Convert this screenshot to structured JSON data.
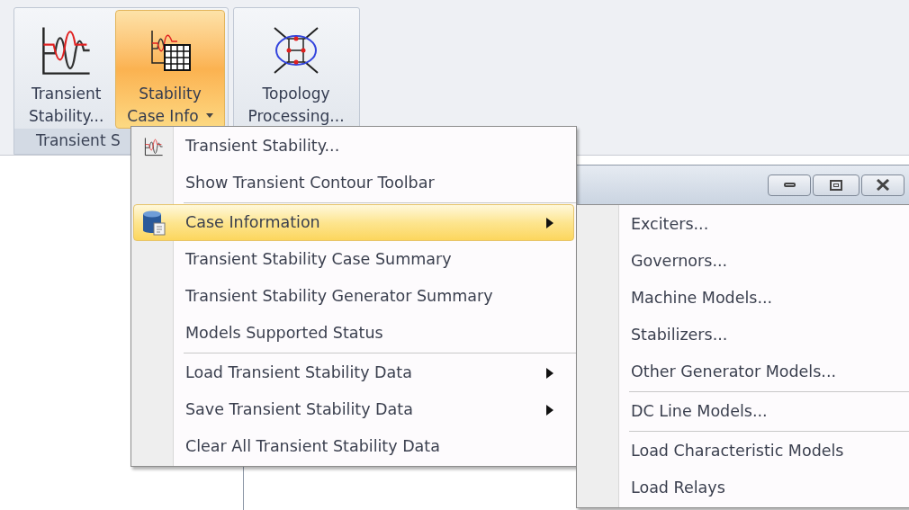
{
  "ribbon": {
    "groups": [
      {
        "label": "Transient S",
        "buttons": [
          {
            "lines": [
              "Transient",
              "Stability..."
            ],
            "selected": false,
            "dropdown": false
          },
          {
            "lines": [
              "Stability",
              "Case Info"
            ],
            "selected": true,
            "dropdown": true
          }
        ]
      },
      {
        "buttons": [
          {
            "lines": [
              "Topology",
              "Processing..."
            ],
            "selected": false,
            "dropdown": false
          }
        ]
      }
    ]
  },
  "menu": {
    "items": [
      {
        "kind": "item",
        "label": "Transient Stability...",
        "submenu": false,
        "selected": false
      },
      {
        "kind": "item",
        "label": "Show Transient Contour Toolbar",
        "submenu": false,
        "selected": false
      },
      {
        "kind": "separator"
      },
      {
        "kind": "item",
        "label": "Case Information",
        "submenu": true,
        "selected": true
      },
      {
        "kind": "item",
        "label": "Transient Stability Case Summary",
        "submenu": false,
        "selected": false
      },
      {
        "kind": "item",
        "label": "Transient Stability Generator Summary",
        "submenu": false,
        "selected": false
      },
      {
        "kind": "item",
        "label": "Models Supported Status",
        "submenu": false,
        "selected": false
      },
      {
        "kind": "separator"
      },
      {
        "kind": "item",
        "label": "Load Transient Stability Data",
        "submenu": true,
        "selected": false
      },
      {
        "kind": "item",
        "label": "Save Transient Stability Data",
        "submenu": true,
        "selected": false
      },
      {
        "kind": "item",
        "label": "Clear All Transient Stability Data",
        "submenu": false,
        "selected": false
      }
    ]
  },
  "submenu": {
    "items": [
      {
        "kind": "item",
        "label": "Exciters..."
      },
      {
        "kind": "item",
        "label": "Governors..."
      },
      {
        "kind": "item",
        "label": "Machine Models..."
      },
      {
        "kind": "item",
        "label": "Stabilizers..."
      },
      {
        "kind": "item",
        "label": "Other Generator Models..."
      },
      {
        "kind": "separator"
      },
      {
        "kind": "item",
        "label": "DC Line Models..."
      },
      {
        "kind": "separator"
      },
      {
        "kind": "item",
        "label": "Load Characteristic Models"
      },
      {
        "kind": "item",
        "label": "Load Relays"
      }
    ]
  }
}
